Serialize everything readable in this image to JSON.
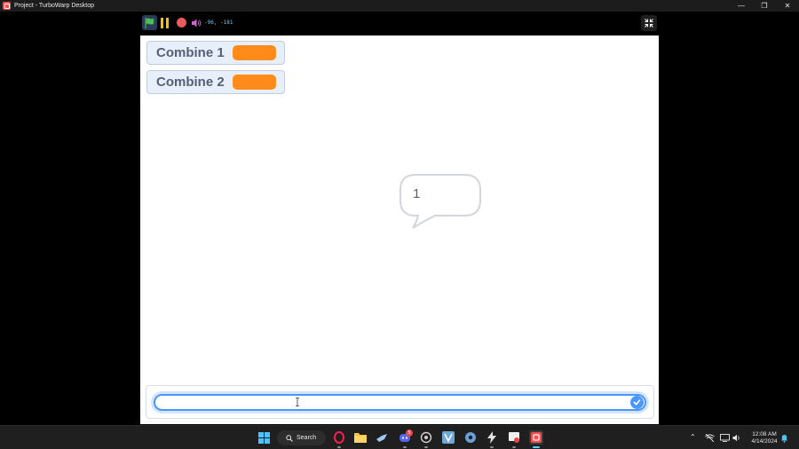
{
  "window": {
    "title": "Project - TurboWarp Desktop",
    "controls": [
      "minimize",
      "restore",
      "close"
    ]
  },
  "toolbar": {
    "coords": "-96, -181",
    "buttons": [
      "green-flag",
      "pause",
      "stop",
      "sound"
    ],
    "fullscreen": "fullscreen-exit"
  },
  "stage": {
    "monitors": [
      {
        "label": "Combine 1",
        "value": ""
      },
      {
        "label": "Combine 2",
        "value": ""
      }
    ],
    "speech_bubble": "1",
    "ask_prompt": {
      "value": "",
      "placeholder": ""
    }
  },
  "taskbar": {
    "search_label": "Search",
    "apps": [
      "windows-start",
      "opera-gx",
      "file-explorer",
      "steam",
      "discord",
      "github",
      "visual-studio",
      "ubisoft",
      "zap",
      "snipping-tool",
      "turbowarp"
    ],
    "discord_badge": "5",
    "clock_time": "12:08 AM",
    "clock_date": "4/14/2024"
  },
  "colors": {
    "stage_bg": "#ffffff",
    "monitor_value": "#ff8c1a",
    "accent": "#4c97ff",
    "flag": "#4cbf56",
    "pause": "#ffbf00",
    "stop": "#ec5959"
  }
}
